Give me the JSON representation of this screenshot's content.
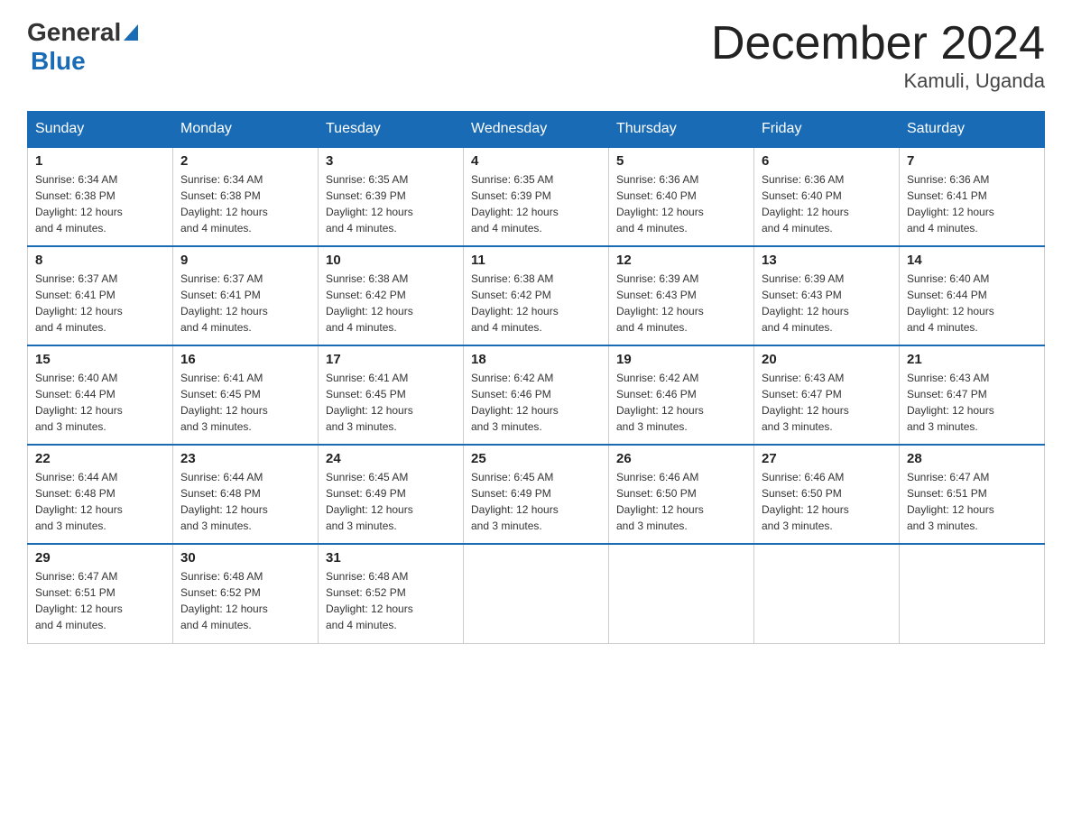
{
  "header": {
    "logo_general": "General",
    "logo_blue": "Blue",
    "title": "December 2024",
    "location": "Kamuli, Uganda"
  },
  "calendar": {
    "days_of_week": [
      "Sunday",
      "Monday",
      "Tuesday",
      "Wednesday",
      "Thursday",
      "Friday",
      "Saturday"
    ],
    "weeks": [
      [
        {
          "num": "1",
          "sunrise": "6:34 AM",
          "sunset": "6:38 PM",
          "daylight": "12 hours and 4 minutes."
        },
        {
          "num": "2",
          "sunrise": "6:34 AM",
          "sunset": "6:38 PM",
          "daylight": "12 hours and 4 minutes."
        },
        {
          "num": "3",
          "sunrise": "6:35 AM",
          "sunset": "6:39 PM",
          "daylight": "12 hours and 4 minutes."
        },
        {
          "num": "4",
          "sunrise": "6:35 AM",
          "sunset": "6:39 PM",
          "daylight": "12 hours and 4 minutes."
        },
        {
          "num": "5",
          "sunrise": "6:36 AM",
          "sunset": "6:40 PM",
          "daylight": "12 hours and 4 minutes."
        },
        {
          "num": "6",
          "sunrise": "6:36 AM",
          "sunset": "6:40 PM",
          "daylight": "12 hours and 4 minutes."
        },
        {
          "num": "7",
          "sunrise": "6:36 AM",
          "sunset": "6:41 PM",
          "daylight": "12 hours and 4 minutes."
        }
      ],
      [
        {
          "num": "8",
          "sunrise": "6:37 AM",
          "sunset": "6:41 PM",
          "daylight": "12 hours and 4 minutes."
        },
        {
          "num": "9",
          "sunrise": "6:37 AM",
          "sunset": "6:41 PM",
          "daylight": "12 hours and 4 minutes."
        },
        {
          "num": "10",
          "sunrise": "6:38 AM",
          "sunset": "6:42 PM",
          "daylight": "12 hours and 4 minutes."
        },
        {
          "num": "11",
          "sunrise": "6:38 AM",
          "sunset": "6:42 PM",
          "daylight": "12 hours and 4 minutes."
        },
        {
          "num": "12",
          "sunrise": "6:39 AM",
          "sunset": "6:43 PM",
          "daylight": "12 hours and 4 minutes."
        },
        {
          "num": "13",
          "sunrise": "6:39 AM",
          "sunset": "6:43 PM",
          "daylight": "12 hours and 4 minutes."
        },
        {
          "num": "14",
          "sunrise": "6:40 AM",
          "sunset": "6:44 PM",
          "daylight": "12 hours and 4 minutes."
        }
      ],
      [
        {
          "num": "15",
          "sunrise": "6:40 AM",
          "sunset": "6:44 PM",
          "daylight": "12 hours and 3 minutes."
        },
        {
          "num": "16",
          "sunrise": "6:41 AM",
          "sunset": "6:45 PM",
          "daylight": "12 hours and 3 minutes."
        },
        {
          "num": "17",
          "sunrise": "6:41 AM",
          "sunset": "6:45 PM",
          "daylight": "12 hours and 3 minutes."
        },
        {
          "num": "18",
          "sunrise": "6:42 AM",
          "sunset": "6:46 PM",
          "daylight": "12 hours and 3 minutes."
        },
        {
          "num": "19",
          "sunrise": "6:42 AM",
          "sunset": "6:46 PM",
          "daylight": "12 hours and 3 minutes."
        },
        {
          "num": "20",
          "sunrise": "6:43 AM",
          "sunset": "6:47 PM",
          "daylight": "12 hours and 3 minutes."
        },
        {
          "num": "21",
          "sunrise": "6:43 AM",
          "sunset": "6:47 PM",
          "daylight": "12 hours and 3 minutes."
        }
      ],
      [
        {
          "num": "22",
          "sunrise": "6:44 AM",
          "sunset": "6:48 PM",
          "daylight": "12 hours and 3 minutes."
        },
        {
          "num": "23",
          "sunrise": "6:44 AM",
          "sunset": "6:48 PM",
          "daylight": "12 hours and 3 minutes."
        },
        {
          "num": "24",
          "sunrise": "6:45 AM",
          "sunset": "6:49 PM",
          "daylight": "12 hours and 3 minutes."
        },
        {
          "num": "25",
          "sunrise": "6:45 AM",
          "sunset": "6:49 PM",
          "daylight": "12 hours and 3 minutes."
        },
        {
          "num": "26",
          "sunrise": "6:46 AM",
          "sunset": "6:50 PM",
          "daylight": "12 hours and 3 minutes."
        },
        {
          "num": "27",
          "sunrise": "6:46 AM",
          "sunset": "6:50 PM",
          "daylight": "12 hours and 3 minutes."
        },
        {
          "num": "28",
          "sunrise": "6:47 AM",
          "sunset": "6:51 PM",
          "daylight": "12 hours and 3 minutes."
        }
      ],
      [
        {
          "num": "29",
          "sunrise": "6:47 AM",
          "sunset": "6:51 PM",
          "daylight": "12 hours and 4 minutes."
        },
        {
          "num": "30",
          "sunrise": "6:48 AM",
          "sunset": "6:52 PM",
          "daylight": "12 hours and 4 minutes."
        },
        {
          "num": "31",
          "sunrise": "6:48 AM",
          "sunset": "6:52 PM",
          "daylight": "12 hours and 4 minutes."
        },
        null,
        null,
        null,
        null
      ]
    ],
    "sunrise_label": "Sunrise: ",
    "sunset_label": "Sunset: ",
    "daylight_label": "Daylight: "
  }
}
